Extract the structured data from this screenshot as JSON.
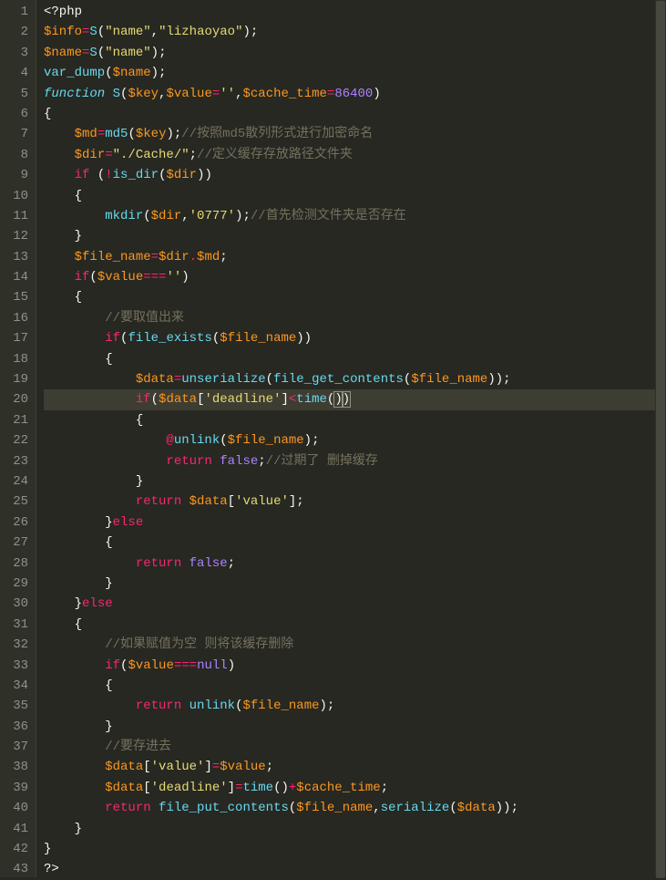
{
  "editor": {
    "activeLine": 20,
    "lines": [
      {
        "n": 1,
        "i": 0,
        "tokens": [
          [
            "php",
            "<?php"
          ]
        ]
      },
      {
        "n": 2,
        "i": 0,
        "tokens": [
          [
            "var",
            "$info"
          ],
          [
            "op",
            "="
          ],
          [
            "fn",
            "S"
          ],
          [
            "punc",
            "("
          ],
          [
            "str",
            "\"name\""
          ],
          [
            "punc",
            ","
          ],
          [
            "str",
            "\"lizhaoyao\""
          ],
          [
            "punc",
            ")"
          ],
          [
            "punc",
            ";"
          ]
        ]
      },
      {
        "n": 3,
        "i": 0,
        "tokens": [
          [
            "var",
            "$name"
          ],
          [
            "op",
            "="
          ],
          [
            "fn",
            "S"
          ],
          [
            "punc",
            "("
          ],
          [
            "str",
            "\"name\""
          ],
          [
            "punc",
            ")"
          ],
          [
            "punc",
            ";"
          ]
        ]
      },
      {
        "n": 4,
        "i": 0,
        "tokens": [
          [
            "fn",
            "var_dump"
          ],
          [
            "punc",
            "("
          ],
          [
            "var",
            "$name"
          ],
          [
            "punc",
            ")"
          ],
          [
            "punc",
            ";"
          ]
        ]
      },
      {
        "n": 5,
        "i": 0,
        "tokens": [
          [
            "kw2",
            "function"
          ],
          [
            "punc",
            " "
          ],
          [
            "fn",
            "S"
          ],
          [
            "punc",
            "("
          ],
          [
            "var",
            "$key"
          ],
          [
            "punc",
            ","
          ],
          [
            "var",
            "$value"
          ],
          [
            "op",
            "="
          ],
          [
            "str",
            "''"
          ],
          [
            "punc",
            ","
          ],
          [
            "var",
            "$cache_time"
          ],
          [
            "op",
            "="
          ],
          [
            "num",
            "86400"
          ],
          [
            "punc",
            ")"
          ]
        ]
      },
      {
        "n": 6,
        "i": 0,
        "tokens": [
          [
            "punc",
            "{"
          ]
        ]
      },
      {
        "n": 7,
        "i": 1,
        "tokens": [
          [
            "var",
            "$md"
          ],
          [
            "op",
            "="
          ],
          [
            "fn",
            "md5"
          ],
          [
            "punc",
            "("
          ],
          [
            "var",
            "$key"
          ],
          [
            "punc",
            ")"
          ],
          [
            "punc",
            ";"
          ],
          [
            "cmt",
            "//按照md5散列形式进行加密命名"
          ]
        ]
      },
      {
        "n": 8,
        "i": 1,
        "tokens": [
          [
            "var",
            "$dir"
          ],
          [
            "op",
            "="
          ],
          [
            "str",
            "\"./Cache/\""
          ],
          [
            "punc",
            ";"
          ],
          [
            "cmt",
            "//定义缓存存放路径文件夹"
          ]
        ]
      },
      {
        "n": 9,
        "i": 1,
        "tokens": [
          [
            "kw",
            "if"
          ],
          [
            "punc",
            " ("
          ],
          [
            "op",
            "!"
          ],
          [
            "fn",
            "is_dir"
          ],
          [
            "punc",
            "("
          ],
          [
            "var",
            "$dir"
          ],
          [
            "punc",
            "))"
          ]
        ]
      },
      {
        "n": 10,
        "i": 1,
        "tokens": [
          [
            "punc",
            "{"
          ]
        ]
      },
      {
        "n": 11,
        "i": 2,
        "tokens": [
          [
            "fn",
            "mkdir"
          ],
          [
            "punc",
            "("
          ],
          [
            "var",
            "$dir"
          ],
          [
            "punc",
            ","
          ],
          [
            "str",
            "'0777'"
          ],
          [
            "punc",
            ")"
          ],
          [
            "punc",
            ";"
          ],
          [
            "cmt",
            "//首先检测文件夹是否存在"
          ]
        ]
      },
      {
        "n": 12,
        "i": 1,
        "tokens": [
          [
            "punc",
            "}"
          ]
        ]
      },
      {
        "n": 13,
        "i": 1,
        "tokens": [
          [
            "var",
            "$file_name"
          ],
          [
            "op",
            "="
          ],
          [
            "var",
            "$dir"
          ],
          [
            "op",
            "."
          ],
          [
            "var",
            "$md"
          ],
          [
            "punc",
            ";"
          ]
        ]
      },
      {
        "n": 14,
        "i": 1,
        "tokens": [
          [
            "kw",
            "if"
          ],
          [
            "punc",
            "("
          ],
          [
            "var",
            "$value"
          ],
          [
            "op",
            "==="
          ],
          [
            "str",
            "''"
          ],
          [
            "punc",
            ")"
          ]
        ]
      },
      {
        "n": 15,
        "i": 1,
        "tokens": [
          [
            "punc",
            "{"
          ]
        ]
      },
      {
        "n": 16,
        "i": 2,
        "tokens": [
          [
            "cmt",
            "//要取值出来"
          ]
        ]
      },
      {
        "n": 17,
        "i": 2,
        "tokens": [
          [
            "kw",
            "if"
          ],
          [
            "punc",
            "("
          ],
          [
            "fn",
            "file_exists"
          ],
          [
            "punc",
            "("
          ],
          [
            "var",
            "$file_name"
          ],
          [
            "punc",
            "))"
          ]
        ]
      },
      {
        "n": 18,
        "i": 2,
        "tokens": [
          [
            "punc",
            "{"
          ]
        ]
      },
      {
        "n": 19,
        "i": 3,
        "tokens": [
          [
            "var",
            "$data"
          ],
          [
            "op",
            "="
          ],
          [
            "fn",
            "unserialize"
          ],
          [
            "punc",
            "("
          ],
          [
            "fn",
            "file_get_contents"
          ],
          [
            "punc",
            "("
          ],
          [
            "var",
            "$file_name"
          ],
          [
            "punc",
            "))"
          ],
          [
            "punc",
            ";"
          ]
        ]
      },
      {
        "n": 20,
        "i": 3,
        "tokens": [
          [
            "kw",
            "if"
          ],
          [
            "punc",
            "("
          ],
          [
            "var",
            "$data"
          ],
          [
            "punc",
            "["
          ],
          [
            "str",
            "'deadline'"
          ],
          [
            "punc",
            "]"
          ],
          [
            "op",
            "<"
          ],
          [
            "fn",
            "time"
          ],
          [
            "punc",
            "("
          ],
          [
            "punc-hl",
            ")"
          ],
          [
            "punc-hl",
            ")"
          ]
        ]
      },
      {
        "n": 21,
        "i": 3,
        "tokens": [
          [
            "punc",
            "{"
          ]
        ]
      },
      {
        "n": 22,
        "i": 4,
        "tokens": [
          [
            "op",
            "@"
          ],
          [
            "fn",
            "unlink"
          ],
          [
            "punc",
            "("
          ],
          [
            "var",
            "$file_name"
          ],
          [
            "punc",
            ")"
          ],
          [
            "punc",
            ";"
          ]
        ]
      },
      {
        "n": 23,
        "i": 4,
        "tokens": [
          [
            "kw",
            "return"
          ],
          [
            "punc",
            " "
          ],
          [
            "bool",
            "false"
          ],
          [
            "punc",
            ";"
          ],
          [
            "cmt",
            "//过期了 删掉缓存"
          ]
        ]
      },
      {
        "n": 24,
        "i": 3,
        "tokens": [
          [
            "punc",
            "}"
          ]
        ]
      },
      {
        "n": 25,
        "i": 3,
        "tokens": [
          [
            "kw",
            "return"
          ],
          [
            "punc",
            " "
          ],
          [
            "var",
            "$data"
          ],
          [
            "punc",
            "["
          ],
          [
            "str",
            "'value'"
          ],
          [
            "punc",
            "]"
          ],
          [
            "punc",
            ";"
          ]
        ]
      },
      {
        "n": 26,
        "i": 2,
        "tokens": [
          [
            "punc",
            "}"
          ],
          [
            "kw",
            "else"
          ]
        ]
      },
      {
        "n": 27,
        "i": 2,
        "tokens": [
          [
            "punc",
            "{"
          ]
        ]
      },
      {
        "n": 28,
        "i": 3,
        "tokens": [
          [
            "kw",
            "return"
          ],
          [
            "punc",
            " "
          ],
          [
            "bool",
            "false"
          ],
          [
            "punc",
            ";"
          ]
        ]
      },
      {
        "n": 29,
        "i": 2,
        "tokens": [
          [
            "punc",
            "}"
          ]
        ]
      },
      {
        "n": 30,
        "i": 1,
        "tokens": [
          [
            "punc",
            "}"
          ],
          [
            "kw",
            "else"
          ]
        ]
      },
      {
        "n": 31,
        "i": 1,
        "tokens": [
          [
            "punc",
            "{"
          ]
        ]
      },
      {
        "n": 32,
        "i": 2,
        "tokens": [
          [
            "cmt",
            "//如果赋值为空 则将该缓存删除"
          ]
        ]
      },
      {
        "n": 33,
        "i": 2,
        "tokens": [
          [
            "kw",
            "if"
          ],
          [
            "punc",
            "("
          ],
          [
            "var",
            "$value"
          ],
          [
            "op",
            "==="
          ],
          [
            "bool",
            "null"
          ],
          [
            "punc",
            ")"
          ]
        ]
      },
      {
        "n": 34,
        "i": 2,
        "tokens": [
          [
            "punc",
            "{"
          ]
        ]
      },
      {
        "n": 35,
        "i": 3,
        "tokens": [
          [
            "kw",
            "return"
          ],
          [
            "punc",
            " "
          ],
          [
            "fn",
            "unlink"
          ],
          [
            "punc",
            "("
          ],
          [
            "var",
            "$file_name"
          ],
          [
            "punc",
            ")"
          ],
          [
            "punc",
            ";"
          ]
        ]
      },
      {
        "n": 36,
        "i": 2,
        "tokens": [
          [
            "punc",
            "}"
          ]
        ]
      },
      {
        "n": 37,
        "i": 2,
        "tokens": [
          [
            "cmt",
            "//要存进去"
          ]
        ]
      },
      {
        "n": 38,
        "i": 2,
        "tokens": [
          [
            "var",
            "$data"
          ],
          [
            "punc",
            "["
          ],
          [
            "str",
            "'value'"
          ],
          [
            "punc",
            "]"
          ],
          [
            "op",
            "="
          ],
          [
            "var",
            "$value"
          ],
          [
            "punc",
            ";"
          ]
        ]
      },
      {
        "n": 39,
        "i": 2,
        "tokens": [
          [
            "var",
            "$data"
          ],
          [
            "punc",
            "["
          ],
          [
            "str",
            "'deadline'"
          ],
          [
            "punc",
            "]"
          ],
          [
            "op",
            "="
          ],
          [
            "fn",
            "time"
          ],
          [
            "punc",
            "()"
          ],
          [
            "op",
            "+"
          ],
          [
            "var",
            "$cache_time"
          ],
          [
            "punc",
            ";"
          ]
        ]
      },
      {
        "n": 40,
        "i": 2,
        "tokens": [
          [
            "kw",
            "return"
          ],
          [
            "punc",
            " "
          ],
          [
            "fn",
            "file_put_contents"
          ],
          [
            "punc",
            "("
          ],
          [
            "var",
            "$file_name"
          ],
          [
            "punc",
            ","
          ],
          [
            "fn",
            "serialize"
          ],
          [
            "punc",
            "("
          ],
          [
            "var",
            "$data"
          ],
          [
            "punc",
            "))"
          ],
          [
            "punc",
            ";"
          ]
        ]
      },
      {
        "n": 41,
        "i": 1,
        "tokens": [
          [
            "punc",
            "}"
          ]
        ]
      },
      {
        "n": 42,
        "i": 0,
        "tokens": [
          [
            "punc",
            "}"
          ]
        ]
      },
      {
        "n": 43,
        "i": 0,
        "tokens": [
          [
            "php",
            "?>"
          ]
        ]
      }
    ]
  }
}
